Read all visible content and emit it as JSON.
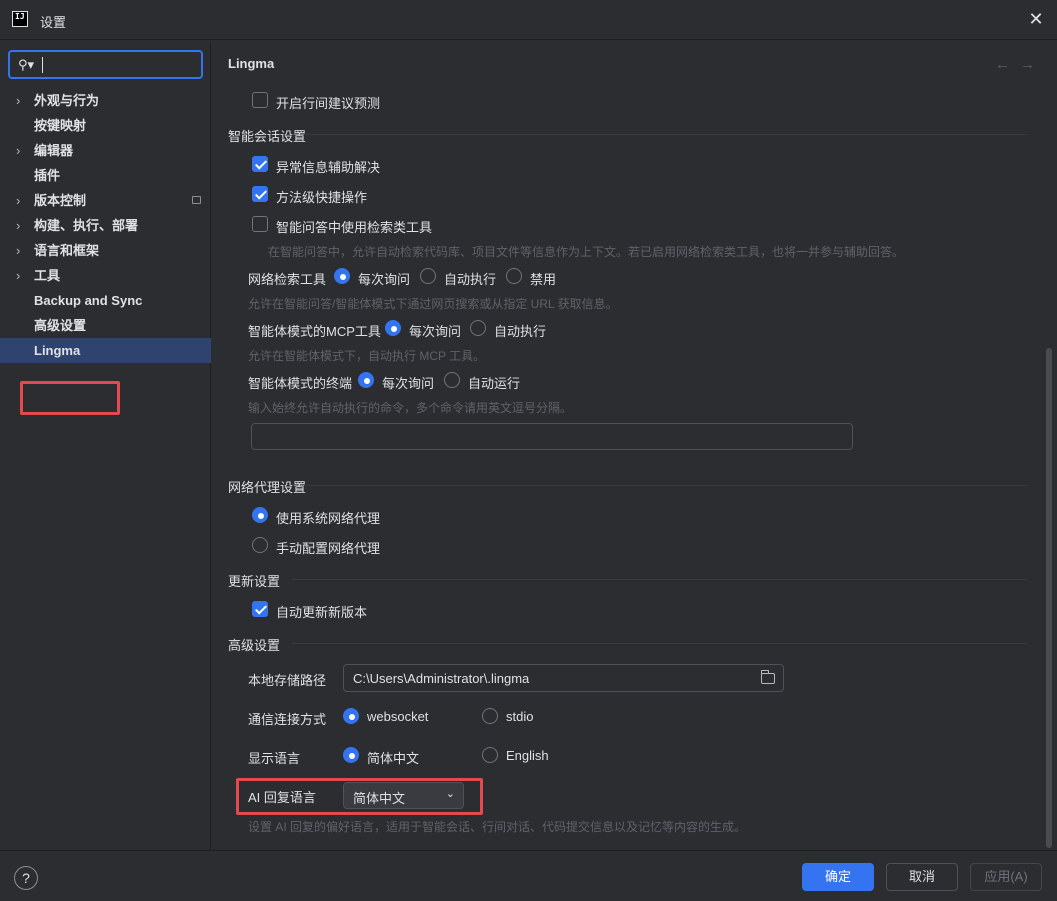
{
  "window": {
    "title": "设置",
    "app_icon_text": "IJ"
  },
  "sidebar": {
    "items": [
      {
        "label": "外观与行为",
        "expandable": true
      },
      {
        "label": "按键映射",
        "expandable": false
      },
      {
        "label": "编辑器",
        "expandable": true
      },
      {
        "label": "插件",
        "expandable": false
      },
      {
        "label": "版本控制",
        "expandable": true
      },
      {
        "label": "构建、执行、部署",
        "expandable": true
      },
      {
        "label": "语言和框架",
        "expandable": true
      },
      {
        "label": "工具",
        "expandable": true
      },
      {
        "label": "Backup and Sync",
        "expandable": false
      },
      {
        "label": "高级设置",
        "expandable": false
      },
      {
        "label": "Lingma",
        "expandable": false,
        "selected": true
      }
    ]
  },
  "main": {
    "title": "Lingma",
    "inline_suggest": {
      "label": "开启行间建议预测",
      "checked": false
    },
    "chat_section": {
      "title": "智能会话设置",
      "exception_assist": {
        "label": "异常信息辅助解决",
        "checked": true
      },
      "method_quick_ops": {
        "label": "方法级快捷操作",
        "checked": true
      },
      "search_tools": {
        "label": "智能问答中使用检索类工具",
        "checked": false
      },
      "search_tools_hint": "在智能问答中，允许自动检索代码库、项目文件等信息作为上下文。若已启用网络检索类工具，也将一并参与辅助回答。",
      "web_search": {
        "label": "网络检索工具",
        "options": [
          "每次询问",
          "自动执行",
          "禁用"
        ],
        "selected": 0,
        "hint": "允许在智能问答/智能体模式下通过网页搜索或从指定 URL 获取信息。"
      },
      "agent_mcp": {
        "label": "智能体模式的MCP工具",
        "options": [
          "每次询问",
          "自动执行"
        ],
        "selected": 0,
        "hint": "允许在智能体模式下，自动执行 MCP 工具。"
      },
      "agent_terminal": {
        "label": "智能体模式的终端",
        "options": [
          "每次询问",
          "自动运行"
        ],
        "selected": 0,
        "hint": "输入始终允许自动执行的命令，多个命令请用英文逗号分隔。",
        "commands_value": ""
      }
    },
    "proxy_section": {
      "title": "网络代理设置",
      "options": [
        "使用系统网络代理",
        "手动配置网络代理"
      ],
      "selected": 0
    },
    "update_section": {
      "title": "更新设置",
      "auto_update": {
        "label": "自动更新新版本",
        "checked": true
      }
    },
    "advanced_section": {
      "title": "高级设置",
      "storage_path": {
        "label": "本地存储路径",
        "value": "C:\\Users\\Administrator\\.lingma"
      },
      "connection": {
        "label": "通信连接方式",
        "options": [
          "websocket",
          "stdio"
        ],
        "selected": 0
      },
      "display_lang": {
        "label": "显示语言",
        "options": [
          "简体中文",
          "English"
        ],
        "selected": 0
      },
      "ai_reply_lang": {
        "label": "AI 回复语言",
        "value": "简体中文"
      },
      "ai_reply_hint": "设置 AI 回复的偏好语言，适用于智能会话、行间对话、代码提交信息以及记忆等内容的生成。"
    }
  },
  "footer": {
    "help": "?",
    "ok": "确定",
    "cancel": "取消",
    "apply": "应用(A)"
  },
  "colors": {
    "accent": "#3574f0",
    "highlight_box": "#e5484d",
    "background": "#2b2d30"
  }
}
